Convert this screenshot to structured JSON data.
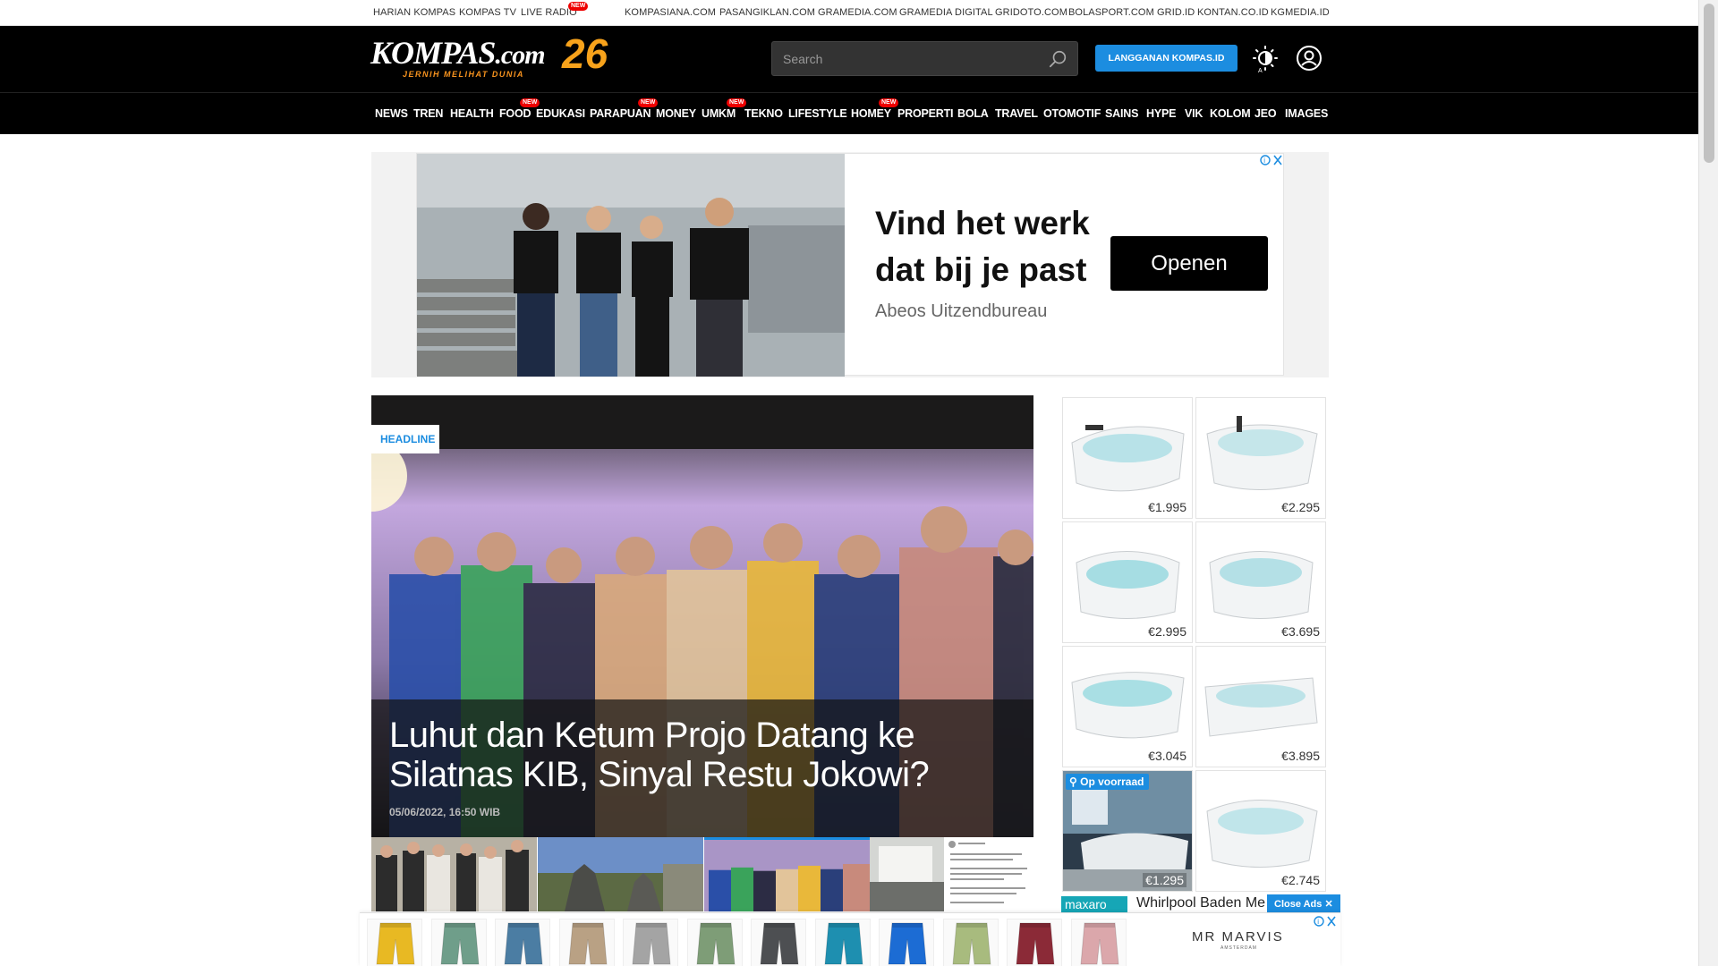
{
  "topbar": {
    "left_links": [
      "HARIAN KOMPAS",
      "KOMPAS TV",
      "LIVE RADIO"
    ],
    "new_label": "NEW",
    "right_links": [
      "KOMPASIANA.COM",
      "PASANGIKLAN.COM",
      "GRAMEDIA.COM",
      "GRAMEDIA DIGITAL",
      "GRIDOTO.COM",
      "BOLASPORT.COM",
      "GRID.ID",
      "KONTAN.CO.ID",
      "KGMEDIA.ID"
    ]
  },
  "header": {
    "logo_text": "KOMPAS",
    "logo_suffix": ".com",
    "logo_tagline": "JERNIH MELIHAT DUNIA",
    "logo_anniversary": "26",
    "search_placeholder": "Search",
    "subscribe_label": "LANGGANAN KOMPAS.ID"
  },
  "nav": {
    "items": [
      "NEWS",
      "TREN",
      "HEALTH",
      "FOOD",
      "EDUKASI",
      "PARAPUAN",
      "MONEY",
      "UMKM",
      "TEKNO",
      "LIFESTYLE",
      "HOMEY",
      "PROPERTI",
      "BOLA",
      "TRAVEL",
      "OTOMOTIF",
      "SAINS",
      "HYPE",
      "VIK",
      "KOLOM",
      "JEO",
      "IMAGES"
    ],
    "new_items": [
      "FOOD",
      "PARAPUAN",
      "UMKM",
      "HOMEY"
    ]
  },
  "top_ad": {
    "headline": "Vind het werk dat bij je past",
    "brand": "Abeos Uitzendbureau",
    "cta": "Openen"
  },
  "headline": {
    "tag": "HEADLINE",
    "title": "Luhut dan Ketum Projo Datang ke Silatnas KIB, Sinyal Restu Jokowi?",
    "date": "05/06/2022, 16:50 WIB"
  },
  "right_ad": {
    "prices": [
      "€1.995",
      "€2.295",
      "€2.995",
      "€3.695",
      "€3.045",
      "€3.895",
      "€1.295",
      "€2.745"
    ],
    "stock_label": "Op voorraad",
    "brand": "maxaro",
    "product_title": "Whirlpool Baden Me",
    "close_label": "Close Ads ✕"
  },
  "bottom_ad": {
    "brand": "MR MARVIS",
    "brand_sub": "AMSTERDAM",
    "short_colors": [
      "#e8b923",
      "#6f9e8a",
      "#4b7da3",
      "#b9a184",
      "#a4a4a4",
      "#7e9d77",
      "#4d4f52",
      "#1e8fb0",
      "#1c6cd4",
      "#a8bb7e",
      "#8b2a37",
      "#dba7ab"
    ]
  },
  "colors": {
    "accent": "#1c8de0",
    "header_bg": "#000000",
    "new_badge": "#e00000"
  }
}
